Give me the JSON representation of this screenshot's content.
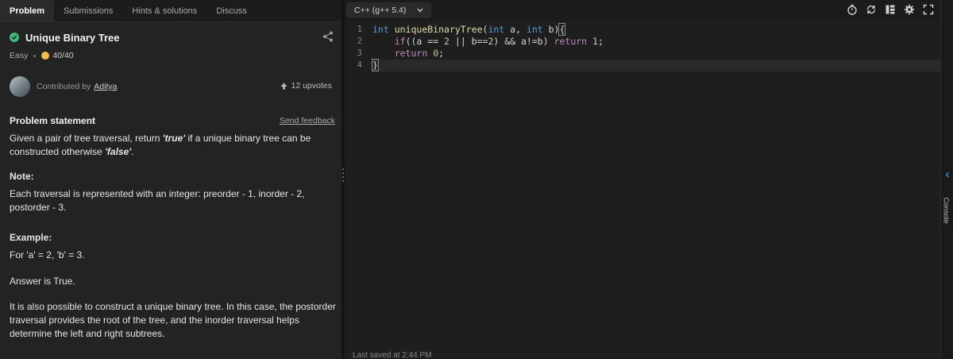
{
  "tabs": [
    "Problem",
    "Submissions",
    "Hints & solutions",
    "Discuss"
  ],
  "problem": {
    "title": "Unique Binary Tree",
    "difficulty": "Easy",
    "score": "40/40",
    "contributed_by": "Contributed by",
    "author": "Aditya",
    "upvotes": "12 upvotes",
    "statement_heading": "Problem statement",
    "send_feedback": "Send feedback",
    "statement_pre": "Given a pair of tree traversal, return ",
    "statement_true": "'true'",
    "statement_mid": " if a unique binary tree can be constructed otherwise ",
    "statement_false": "'false'",
    "statement_end": ".",
    "note_heading": "Note:",
    "note_text": "Each traversal is represented with an integer: preorder - 1, inorder - 2, postorder - 3.",
    "example_heading": "Example:",
    "example_input": "For 'a' = 2, 'b' = 3.",
    "example_answer": "Answer is True.",
    "example_explanation": "It is also possible to construct a unique binary tree. In this case, the postorder traversal provides the root of the tree, and the inorder traversal helps determine the left and right subtrees."
  },
  "editor": {
    "language": "C++ (g++ 5.4)",
    "line_numbers": [
      "1",
      "2",
      "3",
      "4"
    ],
    "last_saved": "Last saved at 2:44 PM"
  },
  "rail": {
    "console": "Console"
  },
  "icons": [
    "check-circle-icon",
    "share-icon",
    "coin-icon",
    "upvote-arrow-icon",
    "chevron-down-icon",
    "timer-icon",
    "refresh-icon",
    "layout-icon",
    "gear-icon",
    "fullscreen-icon"
  ],
  "colors": {
    "accent_green": "#3fb97a",
    "coin": "#f0c24b",
    "keyword": "#569cd6",
    "function": "#dcdcaa",
    "number": "#b5cea8",
    "control": "#c586c0"
  }
}
